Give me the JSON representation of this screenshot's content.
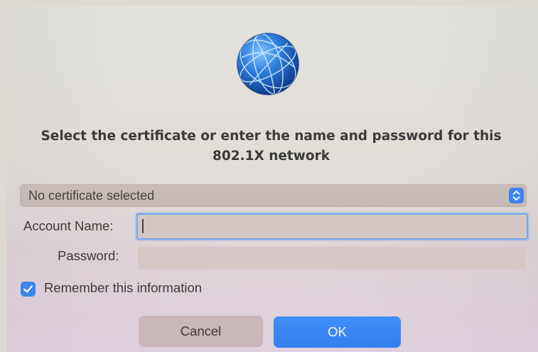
{
  "dialog": {
    "icon": "network-globe-icon",
    "title": "Select the certificate or enter the name and password for this 802.1X network"
  },
  "certificate": {
    "selected": "No certificate selected"
  },
  "fields": {
    "account_label": "Account Name:",
    "account_value": "",
    "password_label": "Password:",
    "password_value": ""
  },
  "remember": {
    "label": "Remember this information",
    "checked": true
  },
  "buttons": {
    "cancel": "Cancel",
    "ok": "OK"
  },
  "colors": {
    "accent": "#3c84f0",
    "focus_ring": "#74a6ec"
  }
}
